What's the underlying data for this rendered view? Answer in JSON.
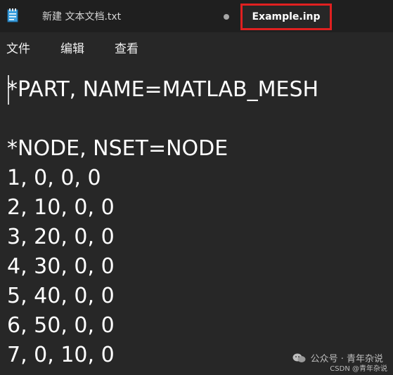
{
  "tabs": [
    {
      "label": "新建 文本文档.txt",
      "active": false
    },
    {
      "label": "Example.inp",
      "active": true
    }
  ],
  "menu": [
    "文件",
    "编辑",
    "查看"
  ],
  "editor": {
    "lines": [
      "*PART, NAME=MATLAB_MESH",
      "",
      "*NODE, NSET=NODE",
      "1, 0, 0, 0",
      "2, 10, 0, 0",
      "3, 20, 0, 0",
      "4, 30, 0, 0",
      "5, 40, 0, 0",
      "6, 50, 0, 0",
      "7, 0, 10, 0"
    ]
  },
  "watermark": {
    "text": "公众号 · 青年杂说",
    "csdn": "CSDN @青年杂说"
  },
  "colors": {
    "background": "#272727",
    "tabbar": "#1f1f1f",
    "highlight": "#e02020",
    "text": "#ffffff"
  },
  "icons": [
    "notepad-icon",
    "unsaved-dot-icon",
    "wechat-icon"
  ]
}
